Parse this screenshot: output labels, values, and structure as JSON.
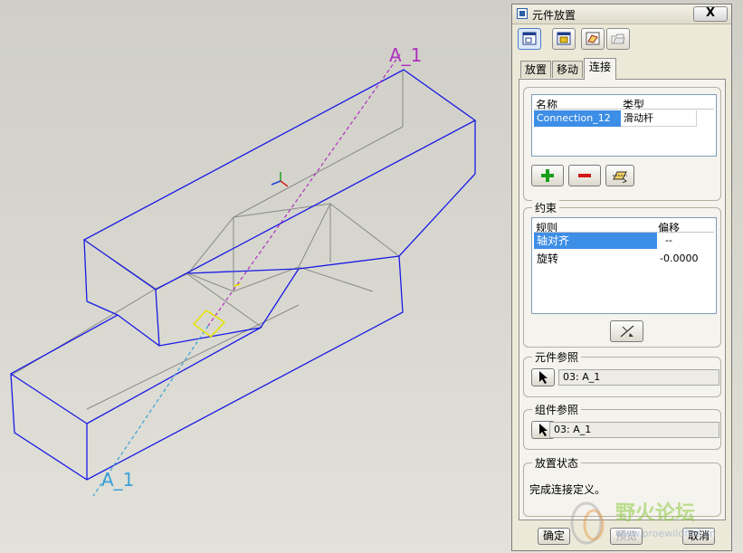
{
  "viewport": {
    "axis_label_top": "A_1",
    "axis_label_bottom": "A_1"
  },
  "dialog": {
    "title": "元件放置",
    "close_label": "X",
    "tabs": [
      {
        "label": "放置",
        "active": false
      },
      {
        "label": "移动",
        "active": false
      },
      {
        "label": "连接",
        "active": true
      }
    ],
    "connections_table": {
      "headers": {
        "name": "名称",
        "type": "类型"
      },
      "rows": [
        {
          "name": "Connection_12",
          "type": "滑动杆",
          "selected": true
        }
      ]
    },
    "constraints": {
      "group_label": "约束",
      "headers": {
        "rule": "规则",
        "offset": "偏移"
      },
      "rows": [
        {
          "rule": "轴对齐",
          "offset": "--",
          "selected": true
        },
        {
          "rule": "旋转",
          "offset": "-0.0000",
          "selected": false
        }
      ]
    },
    "component_ref": {
      "label": "元件参照",
      "value": "03: A_1"
    },
    "assembly_ref": {
      "label": "组件参照",
      "value": "03: A_1"
    },
    "status": {
      "label": "放置状态",
      "text": "完成连接定义。"
    },
    "buttons": {
      "ok": "确定",
      "preview": "预览",
      "cancel": "取消"
    }
  },
  "watermark": {
    "text": "野火论坛",
    "url": "www.proewildfire.cn"
  },
  "colors": {
    "edge": "#1a1ae6",
    "axis_magenta": "#b030c0",
    "axis_cyan": "#3aa0d8",
    "selection": "#3d8ee6",
    "highlight": "#e8e000"
  }
}
